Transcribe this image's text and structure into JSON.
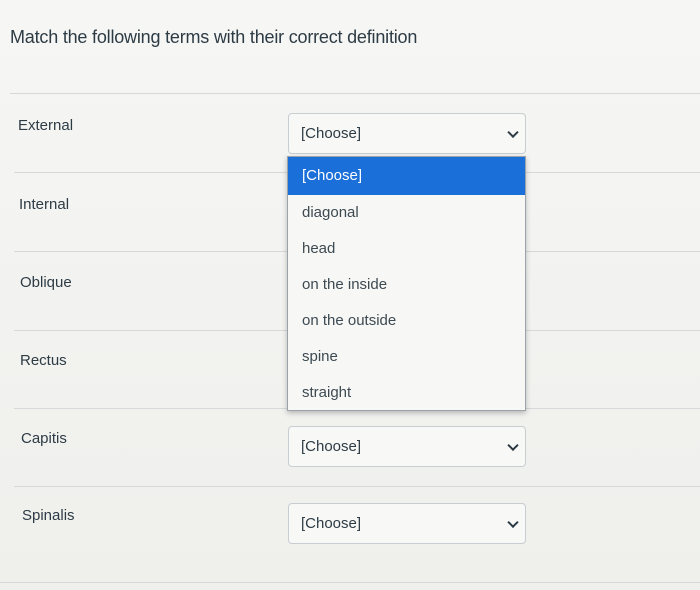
{
  "question": {
    "text": "Match the following terms with their correct definition"
  },
  "rows": [
    {
      "term": "External",
      "select_value": "[Choose]"
    },
    {
      "term": "Internal"
    },
    {
      "term": "Oblique"
    },
    {
      "term": "Rectus"
    },
    {
      "term": "Capitis",
      "select_value": "[Choose]"
    },
    {
      "term": "Spinalis",
      "select_value": "[Choose]"
    }
  ],
  "dropdown": {
    "options": [
      "[Choose]",
      "diagonal",
      "head",
      "on the inside",
      "on the outside",
      "spine",
      "straight"
    ],
    "highlighted_index": 0,
    "highlight_color": "#1a6fd8"
  }
}
